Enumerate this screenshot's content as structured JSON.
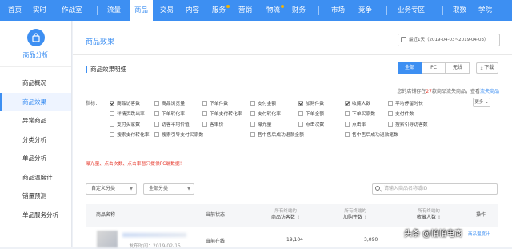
{
  "topnav": {
    "items": [
      {
        "label": "首页"
      },
      {
        "label": "实时"
      },
      {
        "label": "作战室"
      },
      {
        "label": "流量"
      },
      {
        "label": "商品"
      },
      {
        "label": "交易"
      },
      {
        "label": "内容"
      },
      {
        "label": "服务"
      },
      {
        "label": "营销"
      },
      {
        "label": "物流"
      },
      {
        "label": "财务"
      },
      {
        "label": "市场"
      },
      {
        "label": "竞争"
      },
      {
        "label": "业务专区"
      },
      {
        "label": "取数"
      },
      {
        "label": "学院"
      }
    ],
    "active": "商品"
  },
  "sidebar": {
    "title": "商品分析",
    "items": [
      {
        "label": "商品概况"
      },
      {
        "label": "商品效果"
      },
      {
        "label": "异常商品"
      },
      {
        "label": "分类分析"
      },
      {
        "label": "单品分析"
      },
      {
        "label": "商品温度计"
      },
      {
        "label": "销量预测"
      },
      {
        "label": "单品服务分析"
      }
    ]
  },
  "main": {
    "title": "商品效果",
    "date_range": "最近1天（2019-04-03~2019-04-03）",
    "section_title": "商品效果明细",
    "segments": [
      "全部",
      "PC",
      "无线"
    ],
    "download_label": "下载",
    "shop_info": {
      "prefix": "您的店铺存在",
      "count": "27",
      "middle": "款商品流失商品，查看",
      "link": "流失商品"
    },
    "indicator_label": "指标：",
    "more_label": "更多",
    "indicators": [
      [
        {
          "label": "商品访客数",
          "checked": true
        },
        {
          "label": "商品浏览量",
          "checked": false
        },
        {
          "label": "下单件数",
          "checked": false
        },
        {
          "label": "支付金额",
          "checked": false
        },
        {
          "label": "加购件数",
          "checked": true
        },
        {
          "label": "收藏人数",
          "checked": true
        },
        {
          "label": "平均停留时长",
          "checked": false
        }
      ],
      [
        {
          "label": "详情页跳出率",
          "checked": false
        },
        {
          "label": "下单转化率",
          "checked": false
        },
        {
          "label": "下单支付转化率",
          "checked": false
        },
        {
          "label": "支付转化率",
          "checked": false
        },
        {
          "label": "下单金额",
          "checked": false
        },
        {
          "label": "下单买家数",
          "checked": false
        },
        {
          "label": "支付件数",
          "checked": false
        }
      ],
      [
        {
          "label": "支付买家数",
          "checked": false
        },
        {
          "label": "访客平均价值",
          "checked": false
        },
        {
          "label": "客单价",
          "checked": false
        },
        {
          "label": "曝光量",
          "checked": false
        },
        {
          "label": "点击次数",
          "checked": false
        },
        {
          "label": "点击率",
          "checked": false
        },
        {
          "label": "搜索引导访客数",
          "checked": false
        }
      ],
      [
        {
          "label": "搜索支付转化率",
          "checked": false
        },
        {
          "label": "搜索引导支付买家数",
          "checked": false
        },
        {
          "label": "",
          "checked": false
        },
        {
          "label": "售中售后成功退款金额",
          "checked": false
        },
        {
          "label": "",
          "checked": false
        },
        {
          "label": "售中售后成功退款笔数",
          "checked": false
        },
        {
          "label": "",
          "checked": false
        }
      ]
    ],
    "note": "曝光量、点击次数、点击率暂只提供PC端数据！",
    "filters": {
      "custom_category": "自定义分类",
      "all_category": "全部分类",
      "search_placeholder": "请输入商品名称或ID"
    },
    "table": {
      "headers": {
        "name": "商品名称",
        "status": "当前状态",
        "col1_sub": "所有终端的",
        "col1": "商品访客数",
        "col2_sub": "所有终端的",
        "col2": "加购件数",
        "col3_sub": "所有终端的",
        "col3": "收藏人数",
        "action": "操作"
      },
      "rows": [
        {
          "publish": "发布时间：2019-02-15",
          "status": "当前在线",
          "visitors": "19,104",
          "cart": "3,090",
          "action": "商品温度计"
        }
      ]
    }
  },
  "watermark": "头条 @帕帕电商"
}
